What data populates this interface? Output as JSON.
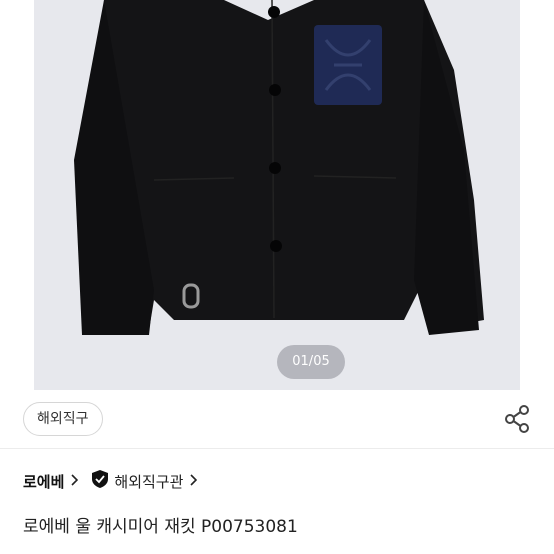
{
  "gallery": {
    "counter": "01/05",
    "image_alt": "Black wool cashmere jacket with navy leather patch pocket"
  },
  "buttons": {
    "lens_icon": "image-search-lens-icon",
    "share_icon": "share-icon"
  },
  "tag": {
    "label": "해외직구"
  },
  "brand": {
    "name": "로에베",
    "official_label": "해외직구관",
    "official_icon": "verified-shield-icon"
  },
  "product": {
    "title": "로에베 울 캐시미어 재킷 P00753081"
  },
  "colors": {
    "gallery_bg": "#e7e8ed",
    "jacket": "#141416",
    "patch": "#1f2a55"
  }
}
